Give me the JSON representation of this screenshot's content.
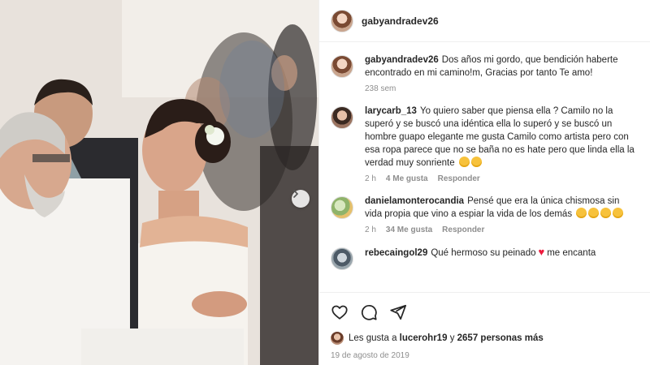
{
  "post": {
    "username": "gabyandradev26",
    "caption": {
      "user": "gabyandradev26",
      "text": "Dos años mi gordo, que bendición haberte encontrado en mi camino!m, Gracias por tanto Te amo!",
      "age": "238 sem"
    },
    "comments": [
      {
        "user": "larycarb_13",
        "text": "Yo quiero saber que piensa ella ? Camilo no la superó y se buscó una idéntica ella lo superó y se buscó un hombre guapo elegante me gusta Camilo como artista pero con esa ropa parece que no se baña no es hate pero que linda ella la verdad muy sonriente",
        "time": "2 h",
        "likes": "4 Me gusta",
        "reply": "Responder"
      },
      {
        "user": "danielamonterocandia",
        "text": "Pensé que era la única chismosa sin vida propia que vino a espiar la vida de los demás",
        "time": "2 h",
        "likes": "34 Me gusta",
        "reply": "Responder"
      },
      {
        "user": "rebecaingol29",
        "text": "Qué hermoso su peinado",
        "text_after": "me encanta"
      }
    ],
    "likes": {
      "prefix": "Les gusta a",
      "user": "lucerohr19",
      "connector": "y",
      "others": "2657 personas más"
    },
    "date": "19 de agosto de 2019"
  },
  "icons": {
    "like": "heart-outline-icon",
    "comment": "comment-bubble-icon",
    "share": "paper-plane-icon",
    "next": "chevron-right-icon"
  },
  "colors": {
    "text": "#262626",
    "muted": "#8e8e8e",
    "heart": "#ed1b3d",
    "divider": "#efefef"
  }
}
